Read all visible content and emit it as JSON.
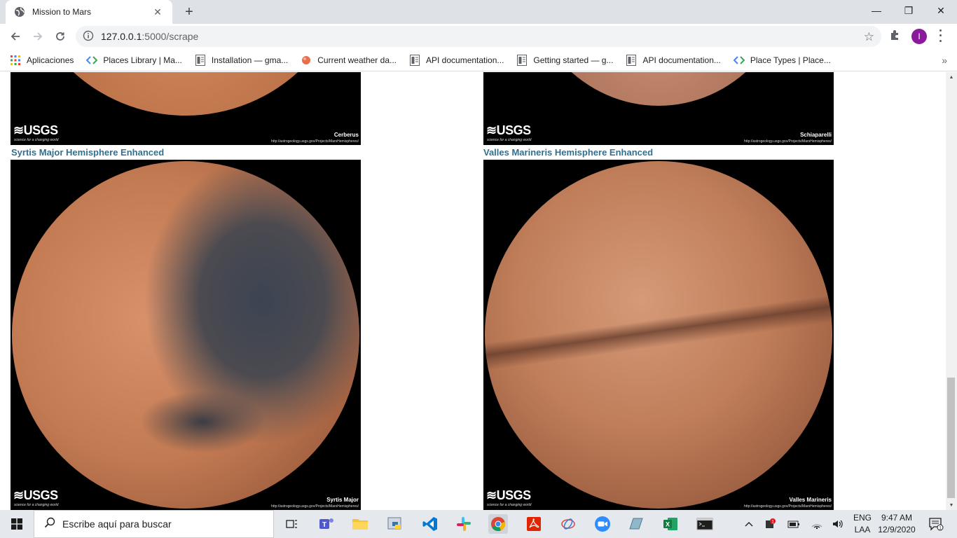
{
  "browser": {
    "tab_title": "Mission to Mars",
    "tab_close": "✕",
    "new_tab": "+",
    "url_host": "127.0.0.1",
    "url_rest": ":5000/scrape",
    "avatar_letter": "I",
    "window_controls": {
      "minimize": "—",
      "maximize": "❐",
      "close": "✕"
    }
  },
  "bookmarks": [
    {
      "label": "Aplicaciones",
      "icon": "apps-grid-icon"
    },
    {
      "label": "Places Library  |  Ma...",
      "icon": "maps-api-icon"
    },
    {
      "label": "Installation — gma...",
      "icon": "doc-page-icon"
    },
    {
      "label": "Current weather da...",
      "icon": "weather-icon"
    },
    {
      "label": "API documentation...",
      "icon": "doc-page-icon"
    },
    {
      "label": "Getting started — g...",
      "icon": "doc-page-icon"
    },
    {
      "label": "API documentation...",
      "icon": "doc-page-icon"
    },
    {
      "label": "Place Types  |  Place...",
      "icon": "maps-api-icon"
    }
  ],
  "bookmarks_more": "»",
  "page": {
    "top_images": [
      {
        "name": "Cerberus",
        "url": "http://astrogeology.usgs.gov/Projects/MarsHemispheres/"
      },
      {
        "name": "Schiaparelli",
        "url": "http://astrogeology.usgs.gov/Projects/MarsHemispheres/"
      }
    ],
    "hemispheres": [
      {
        "title": "Syrtis Major Hemisphere Enhanced",
        "name": "Syrtis Major",
        "url": "http://astrogeology.usgs.gov/Projects/MarsHemispheres/"
      },
      {
        "title": "Valles Marineris Hemisphere Enhanced",
        "name": "Valles Marineris",
        "url": "http://astrogeology.usgs.gov/Projects/MarsHemispheres/"
      }
    ],
    "usgs_logo": "≋USGS",
    "usgs_tagline": "science for a changing world"
  },
  "taskbar": {
    "search_placeholder": "Escribe aquí para buscar",
    "lang_top": "ENG",
    "lang_bottom": "LAA",
    "time": "9:47 AM",
    "date": "12/9/2020",
    "notifications": "1",
    "apps": [
      "task-view-icon",
      "teams-icon",
      "file-explorer-icon",
      "python-launcher-icon",
      "vscode-icon",
      "slack-icon",
      "chrome-icon",
      "acrobat-icon",
      "paint-icon",
      "zoom-icon",
      "glass-app-icon",
      "excel-icon",
      "terminal-icon"
    ]
  },
  "colors": {
    "link_title": "#31708f",
    "mars_orange": "#c8794f",
    "chrome_frame": "#dee1e6"
  }
}
